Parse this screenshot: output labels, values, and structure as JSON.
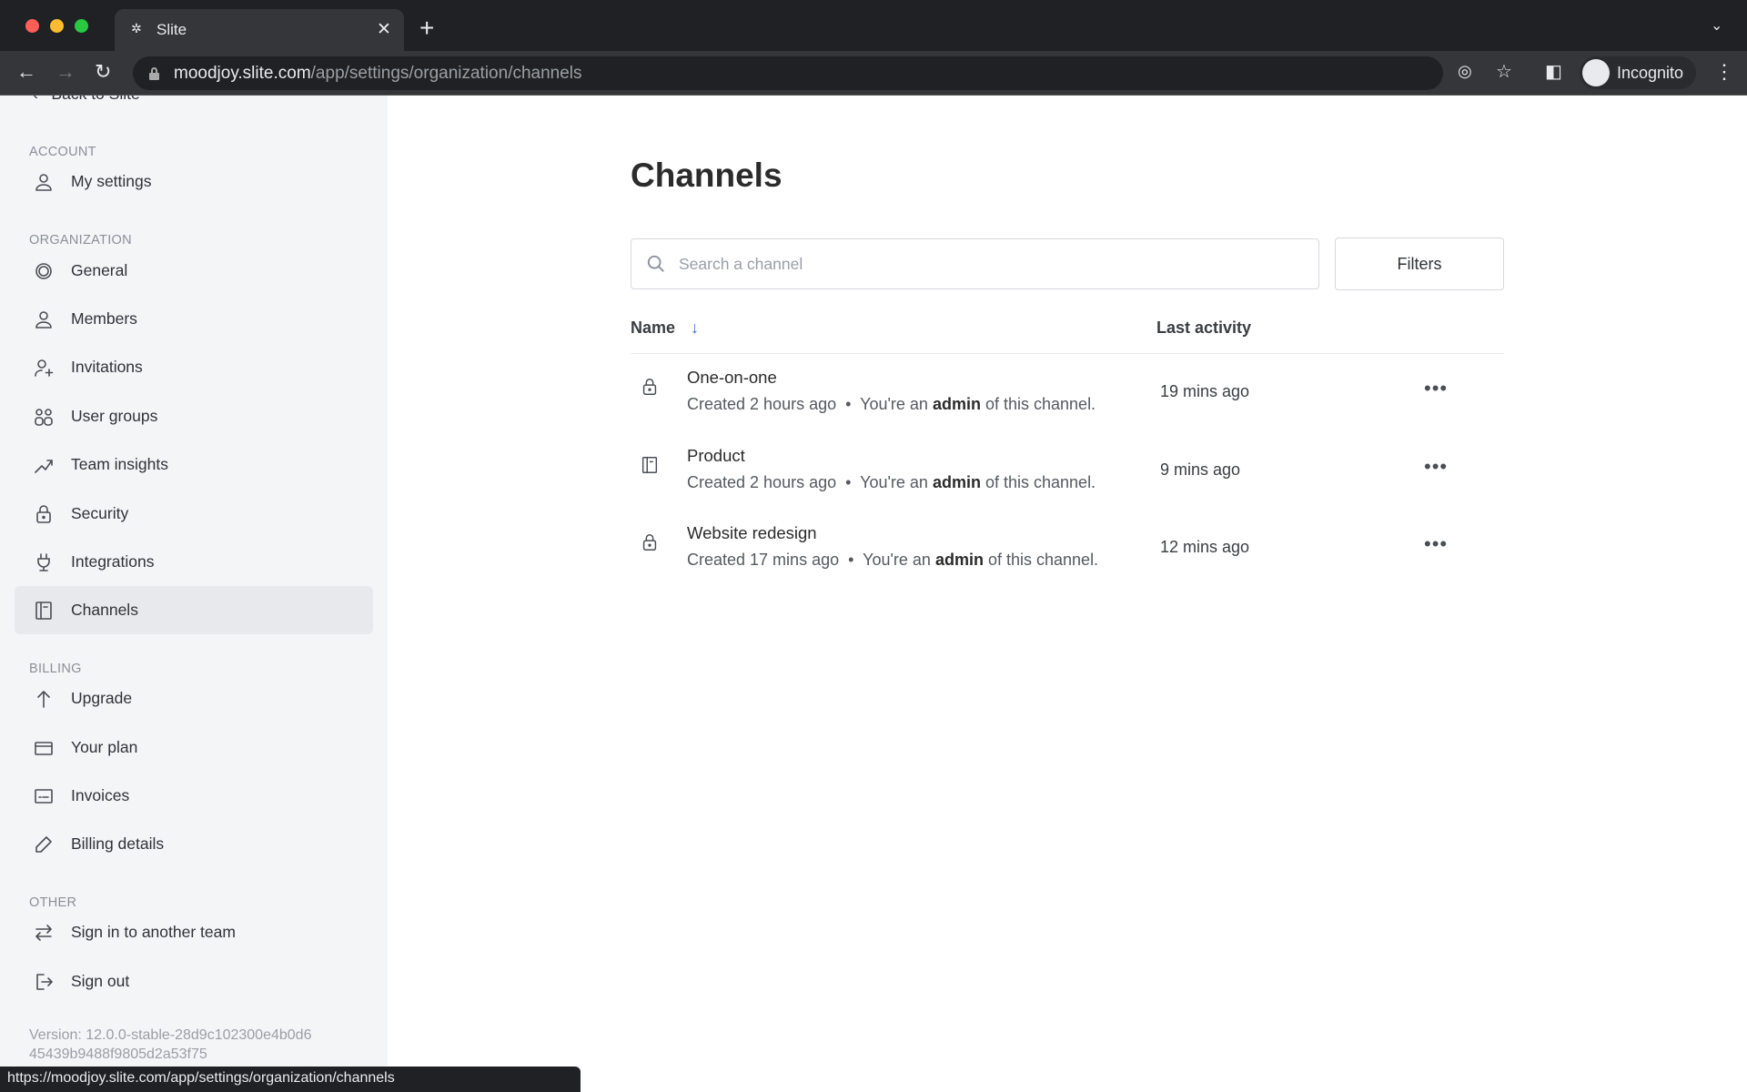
{
  "browser": {
    "tab_title": "Slite",
    "url_host": "moodjoy.slite.com",
    "url_path": "/app/settings/organization/channels",
    "profile": "Incognito",
    "status_url": "https://moodjoy.slite.com/app/settings/organization/channels"
  },
  "sidebar": {
    "back": "Back to Slite",
    "sections": [
      {
        "label": "ACCOUNT",
        "items": [
          {
            "label": "My settings",
            "icon": "user-icon"
          }
        ]
      },
      {
        "label": "ORGANIZATION",
        "items": [
          {
            "label": "General",
            "icon": "gear-icon"
          },
          {
            "label": "Members",
            "icon": "user-icon"
          },
          {
            "label": "Invitations",
            "icon": "user-plus-icon"
          },
          {
            "label": "User groups",
            "icon": "user-groups-icon"
          },
          {
            "label": "Team insights",
            "icon": "trend-icon"
          },
          {
            "label": "Security",
            "icon": "lock-icon"
          },
          {
            "label": "Integrations",
            "icon": "plug-icon"
          },
          {
            "label": "Channels",
            "icon": "channel-icon",
            "active": true
          }
        ]
      },
      {
        "label": "BILLING",
        "items": [
          {
            "label": "Upgrade",
            "icon": "arrow-up-icon"
          },
          {
            "label": "Your plan",
            "icon": "card-icon"
          },
          {
            "label": "Invoices",
            "icon": "invoice-icon"
          },
          {
            "label": "Billing details",
            "icon": "pencil-icon"
          }
        ]
      },
      {
        "label": "OTHER",
        "items": [
          {
            "label": "Sign in to another team",
            "icon": "switch-icon"
          },
          {
            "label": "Sign out",
            "icon": "sign-out-icon"
          }
        ]
      }
    ],
    "version_line1": "Version: 12.0.0-stable-28d9c102300e4b0d6",
    "version_line2": "45439b9488f9805d2a53f75"
  },
  "main": {
    "title": "Channels",
    "search_placeholder": "Search a channel",
    "filters_label": "Filters",
    "columns": {
      "name": "Name",
      "last_activity": "Last activity"
    },
    "sort_color": "#2f6fd6",
    "channels": [
      {
        "name": "One-on-one",
        "icon": "lock-icon",
        "created": "Created 2 hours ago",
        "role_pre": "You're an",
        "role": "admin",
        "role_post": "of this channel.",
        "last_activity": "19 mins ago"
      },
      {
        "name": "Product",
        "icon": "channel-icon",
        "created": "Created 2 hours ago",
        "role_pre": "You're an",
        "role": "admin",
        "role_post": "of this channel.",
        "last_activity": "9 mins ago"
      },
      {
        "name": "Website redesign",
        "icon": "lock-icon",
        "created": "Created 17 mins ago",
        "role_pre": "You're an",
        "role": "admin",
        "role_post": "of this channel.",
        "last_activity": "12 mins ago"
      }
    ]
  }
}
